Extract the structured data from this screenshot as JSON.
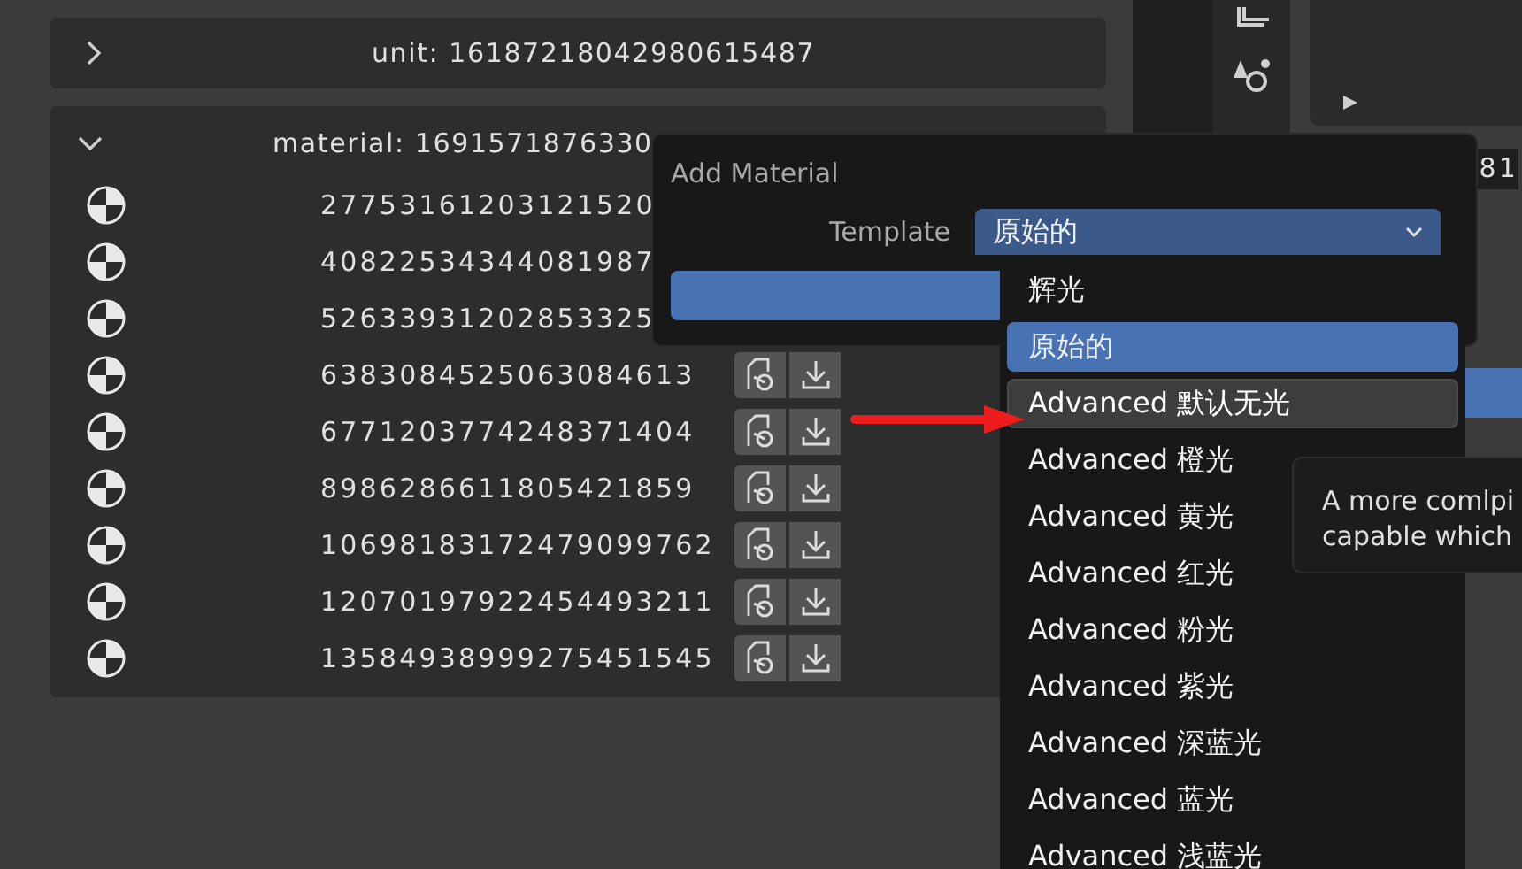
{
  "unit_panel": {
    "title": "unit: 16187218042980615487",
    "expanded": false
  },
  "material_panel": {
    "title": "material: 1691571876330",
    "expanded": true,
    "rows_without_actions": [
      {
        "id": "27753161203121520"
      },
      {
        "id": "40822534344081987"
      }
    ],
    "rows": [
      {
        "id": "52633931202853325"
      },
      {
        "id": "6383084525063084613"
      },
      {
        "id": "6771203774248371404"
      },
      {
        "id": "8986286611805421859"
      },
      {
        "id": "10698183172479099762"
      },
      {
        "id": "12070197922454493211"
      },
      {
        "id": "13584938999275451545"
      }
    ]
  },
  "side_field": {
    "value": "81"
  },
  "dialog": {
    "title": "Add Material",
    "field_label": "Template",
    "value": "原始的"
  },
  "menu": {
    "items": [
      {
        "label": "辉光",
        "selected": false,
        "highlighted": false
      },
      {
        "label": "原始的",
        "selected": true,
        "highlighted": false
      },
      {
        "label": "Advanced 默认无光",
        "selected": false,
        "highlighted": true
      },
      {
        "label": "Advanced 橙光",
        "selected": false,
        "highlighted": false
      },
      {
        "label": "Advanced 黄光",
        "selected": false,
        "highlighted": false
      },
      {
        "label": "Advanced 红光",
        "selected": false,
        "highlighted": false
      },
      {
        "label": "Advanced 粉光",
        "selected": false,
        "highlighted": false
      },
      {
        "label": "Advanced 紫光",
        "selected": false,
        "highlighted": false
      },
      {
        "label": "Advanced 深蓝光",
        "selected": false,
        "highlighted": false
      },
      {
        "label": "Advanced 蓝光",
        "selected": false,
        "highlighted": false
      },
      {
        "label": "Advanced 浅蓝光",
        "selected": false,
        "highlighted": false
      }
    ]
  },
  "tooltip": {
    "lines": [
      "A more comlpi",
      "capable which"
    ]
  }
}
